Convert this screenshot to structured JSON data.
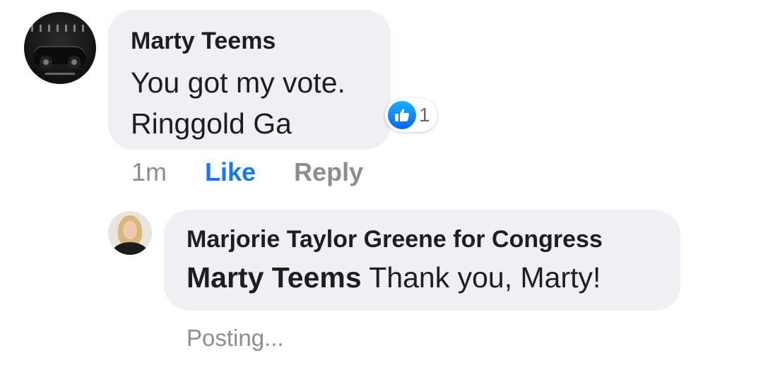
{
  "comment": {
    "author": "Marty Teems",
    "text_line1": "You got my vote.",
    "text_line2": "Ringgold Ga",
    "reaction_icon": "thumbs-up-icon",
    "reaction_count": "1",
    "time": "1m",
    "like_label": "Like",
    "reply_label": "Reply"
  },
  "reply": {
    "author": "Marjorie Taylor Greene for Congress",
    "mention": "Marty Teems",
    "text": "Thank you, Marty!",
    "status": "Posting..."
  },
  "colors": {
    "bubble": "#eff0f3",
    "link_blue": "#1877f2",
    "muted": "#8a8d91",
    "text": "#1c1e21"
  }
}
